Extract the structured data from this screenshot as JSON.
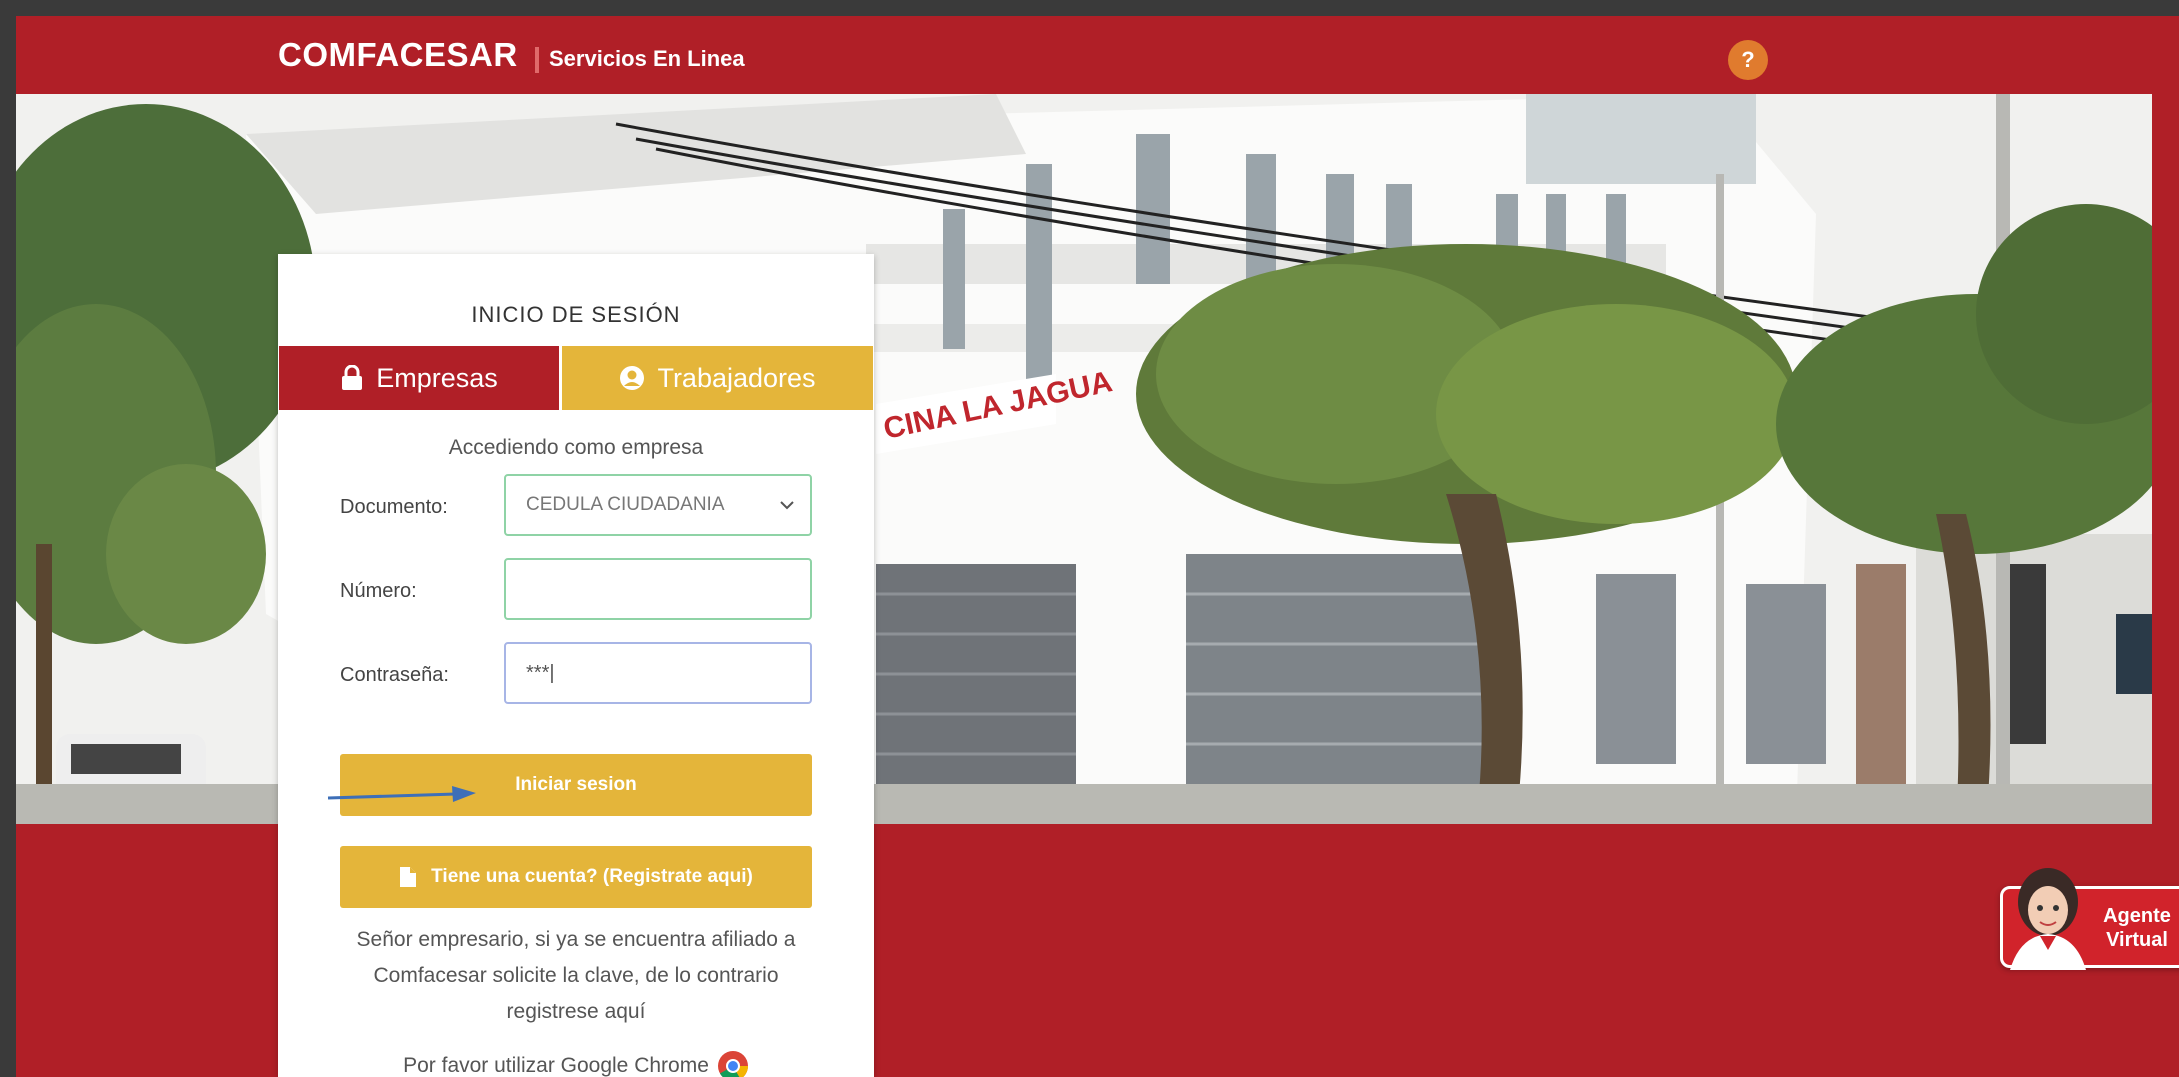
{
  "header": {
    "brand": "COMFACESAR",
    "subtitle": "Servicios En Linea",
    "help_label": "?"
  },
  "colors": {
    "brand_red": "#b01f27",
    "accent_yellow": "#e4b53a",
    "help_orange": "#e07b2e"
  },
  "login": {
    "title": "INICIO DE SESIÓN",
    "tabs": [
      {
        "label": "Empresas",
        "icon": "lock-icon",
        "active": true
      },
      {
        "label": "Trabajadores",
        "icon": "user-circle-icon",
        "active": false
      }
    ],
    "subtitle": "Accediendo como empresa",
    "document_label": "Documento:",
    "document_value": "CEDULA CIUDADANIA",
    "number_label": "Número:",
    "number_value": "",
    "password_label": "Contraseña:",
    "password_value": "***|",
    "login_button": "Iniciar sesion",
    "register_button": "Tiene una cuenta? (Registrate aqui)",
    "info_text": "Señor empresario, si ya se encuentra afiliado a Comfacesar solicite la clave, de lo contrario registrese aquí",
    "chrome_text": "Por favor utilizar Google Chrome"
  },
  "agent": {
    "line1": "Agente",
    "line2": "Virtual"
  }
}
